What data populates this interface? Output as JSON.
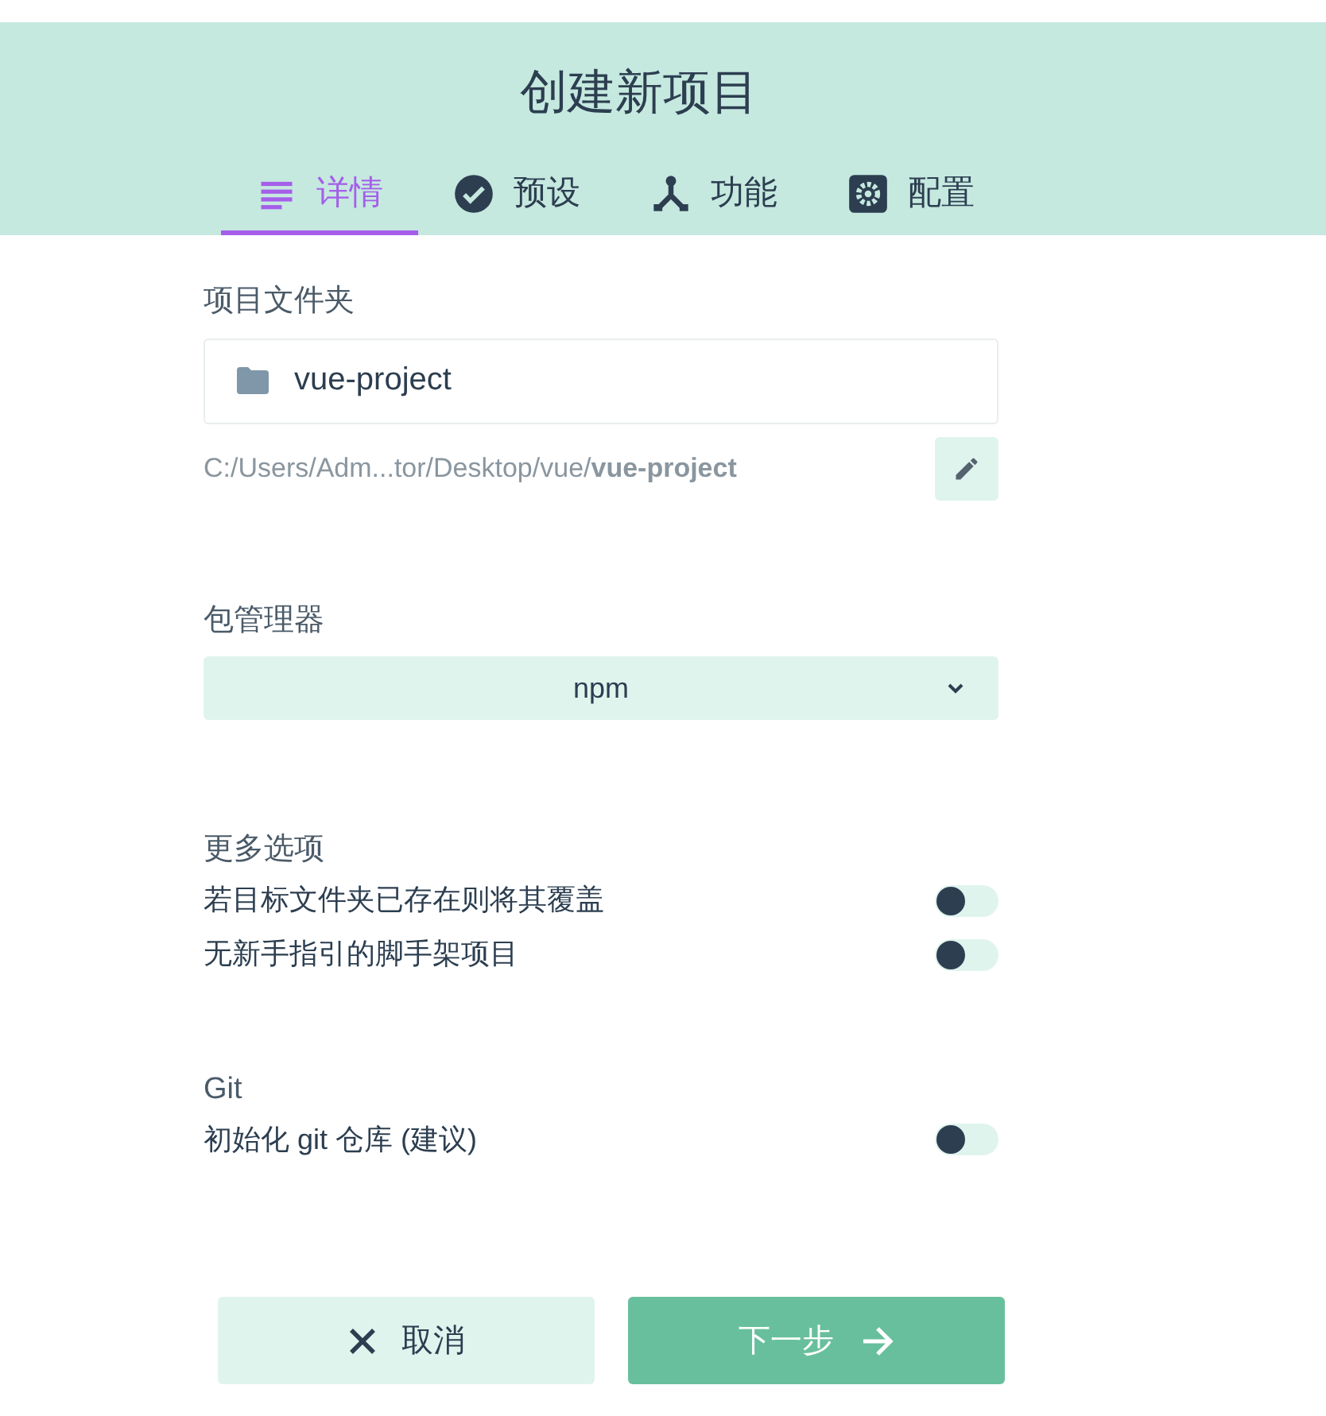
{
  "header": {
    "title": "创建新项目"
  },
  "tabs": [
    {
      "label": "详情",
      "selected": true
    },
    {
      "label": "预设",
      "selected": false
    },
    {
      "label": "功能",
      "selected": false
    },
    {
      "label": "配置",
      "selected": false
    }
  ],
  "folder": {
    "label": "项目文件夹",
    "value": "vue-project",
    "path": "C:/Users/Adm...tor/Desktop/vue/**vue-project**"
  },
  "package_manager": {
    "label": "包管理器",
    "value": "npm"
  },
  "more_options": {
    "label": "更多选项",
    "toggles": [
      {
        "label": "若目标文件夹已存在则将其覆盖",
        "on": false
      },
      {
        "label": "无新手指引的脚手架项目",
        "on": false
      }
    ]
  },
  "git": {
    "label": "Git",
    "toggles": [
      {
        "label": "初始化 git 仓库 (建议)",
        "on": false
      }
    ]
  },
  "buttons": [
    {
      "label": "取消",
      "kind": "cancel"
    },
    {
      "label": "下一步",
      "kind": "next"
    }
  ]
}
